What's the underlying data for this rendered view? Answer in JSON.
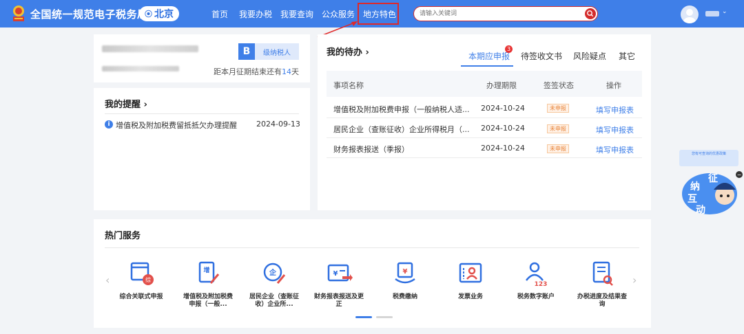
{
  "header": {
    "site_title": "全国统一规范电子税务局",
    "city": "北京",
    "nav": [
      "首页",
      "我要办税",
      "我要查询",
      "公众服务",
      "地方特色"
    ],
    "search_placeholder": "请输入关键词"
  },
  "profile": {
    "badge_letter": "B",
    "badge_text": "级纳税人",
    "deadline_prefix": "距本月征期结束还有",
    "deadline_days": "14",
    "deadline_suffix": "天"
  },
  "reminders": {
    "title": "我的提醒 ›",
    "items": [
      {
        "text": "增值税及附加税费留抵抵欠办理提醒",
        "date": "2024-09-13"
      }
    ]
  },
  "todo": {
    "title": "我的待办 ›",
    "tabs": [
      "本期应申报",
      "待签收文书",
      "风险疑点",
      "其它"
    ],
    "tab_count": "3",
    "columns": [
      "事项名称",
      "办理期限",
      "签签状态",
      "操作"
    ],
    "rows": [
      {
        "name": "增值税及附加税费申报（一般纳税人适...",
        "deadline": "2024-10-24",
        "status": "未申报",
        "action": "填写申报表"
      },
      {
        "name": "居民企业（查账征收）企业所得税月（...",
        "deadline": "2024-10-24",
        "status": "未申报",
        "action": "填写申报表"
      },
      {
        "name": "财务报表报送（季报）",
        "deadline": "2024-10-24",
        "status": "未申报",
        "action": "填写申报表"
      }
    ]
  },
  "hot_services": {
    "title": "热门服务",
    "items": [
      {
        "label": "综合关联式申报",
        "icon": "comprehensive-declaration-icon"
      },
      {
        "label": "增值税及附加税费申报（一般...",
        "icon": "vat-declaration-icon"
      },
      {
        "label": "居民企业（查账征收）企业所...",
        "icon": "enterprise-income-tax-icon"
      },
      {
        "label": "财务报表报送及更正",
        "icon": "financial-report-icon"
      },
      {
        "label": "税费缴纳",
        "icon": "tax-payment-icon"
      },
      {
        "label": "发票业务",
        "icon": "invoice-icon"
      },
      {
        "label": "税务数字账户",
        "icon": "digital-account-icon"
      },
      {
        "label": "办税进度及结果查询",
        "icon": "progress-query-icon"
      }
    ]
  },
  "float_widget": {
    "tip": "您有可查询的优惠政策",
    "chars": [
      "征",
      "纳",
      "互",
      "动"
    ]
  },
  "colors": {
    "primary": "#3f7fe8",
    "highlight_red": "#e02828",
    "status_orange": "#e8853a"
  }
}
